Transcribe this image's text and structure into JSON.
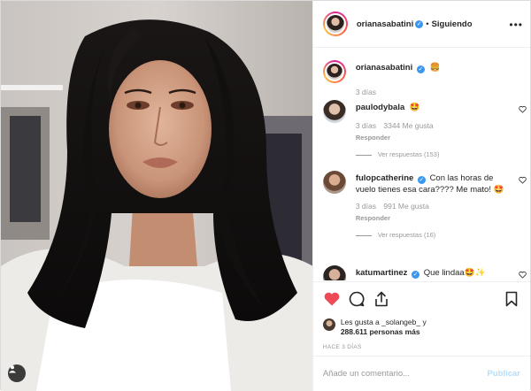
{
  "post": {
    "author": "orianasabatini",
    "follow_status": "Siguiendo",
    "dot": "•",
    "more": "•••"
  },
  "caption": {
    "user": "orianasabatini",
    "emoji": "🍔",
    "time": "3 días"
  },
  "comments": [
    {
      "user": "paulodybala",
      "text": "🤩",
      "time": "3 días",
      "likes": "3344 Me gusta",
      "reply": "Responder",
      "view_replies": "Ver respuestas (153)"
    },
    {
      "user": "fulopcatherine",
      "text": "Con las horas de vuelo tienes esa cara???? Me mato! 🤩",
      "time": "3 días",
      "likes": "991 Me gusta",
      "reply": "Responder",
      "view_replies": "Ver respuestas (16)"
    },
    {
      "user": "katumartinez",
      "text": "Que lindaa🤩✨"
    }
  ],
  "likes": {
    "line1": "Les gusta a _solangeb_ y",
    "line2": "288.611 personas más"
  },
  "posted_ago": "HACE 3 DÍAS",
  "composer": {
    "placeholder": "Añade un comentario...",
    "publish": "Publicar"
  },
  "colors": {
    "like_red": "#ed4956",
    "verified_blue": "#3897f0",
    "publish_disabled": "#b2dffc"
  }
}
